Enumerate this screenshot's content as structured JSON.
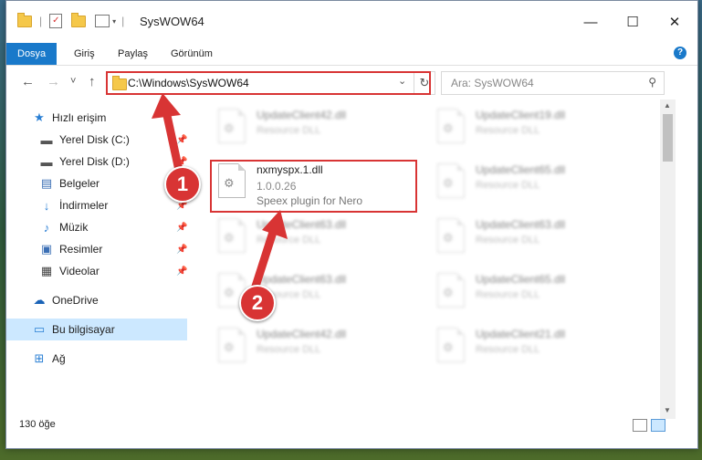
{
  "window": {
    "title": "SysWOW64",
    "controls": {
      "minimize": "—",
      "maximize": "☐",
      "close": "✕"
    }
  },
  "ribbon": {
    "tabs": [
      {
        "label": "Dosya",
        "active": true
      },
      {
        "label": "Giriş",
        "active": false
      },
      {
        "label": "Paylaş",
        "active": false
      },
      {
        "label": "Görünüm",
        "active": false
      }
    ],
    "help": "?"
  },
  "nav": {
    "back": "←",
    "forward": "→",
    "recent": "˅",
    "up": "↑",
    "address": "C:\\Windows\\SysWOW64",
    "address_dropdown": "⌄",
    "refresh": "↻",
    "search_placeholder": "Ara: SysWOW64",
    "search_icon": "⚲"
  },
  "sidebar": {
    "items": [
      {
        "label": "Hızlı erişim",
        "icon": "star-icon",
        "glyph": "★",
        "color": "#2a7fd4"
      },
      {
        "label": "Yerel Disk (C:)",
        "icon": "drive-icon",
        "glyph": "▬",
        "color": "#555555",
        "pinned": true
      },
      {
        "label": "Yerel Disk (D:)",
        "icon": "drive-icon",
        "glyph": "▬",
        "color": "#555555",
        "pinned": true
      },
      {
        "label": "Belgeler",
        "icon": "documents-icon",
        "glyph": "▤",
        "color": "#3b6fb5",
        "pinned": true
      },
      {
        "label": "İndirmeler",
        "icon": "download-icon",
        "glyph": "↓",
        "color": "#2a7fd4",
        "pinned": true
      },
      {
        "label": "Müzik",
        "icon": "music-icon",
        "glyph": "♪",
        "color": "#2a7fd4",
        "pinned": true
      },
      {
        "label": "Resimler",
        "icon": "pictures-icon",
        "glyph": "▣",
        "color": "#3b6fb5",
        "pinned": true
      },
      {
        "label": "Videolar",
        "icon": "video-icon",
        "glyph": "▦",
        "color": "#444444",
        "pinned": true
      },
      {
        "label": "OneDrive",
        "icon": "cloud-icon",
        "glyph": "☁",
        "color": "#1a63b7"
      },
      {
        "label": "Bu bilgisayar",
        "icon": "computer-icon",
        "glyph": "▭",
        "color": "#2a7fd4",
        "selected": true
      },
      {
        "label": "Ağ",
        "icon": "network-icon",
        "glyph": "⊞",
        "color": "#2a7fd4"
      }
    ],
    "pin_glyph": "📌"
  },
  "files": {
    "left": [
      {
        "name": "UpdateClient42.dll",
        "desc": "Resource DLL"
      },
      {
        "name": "nxmyspx.1.dll",
        "version": "1.0.0.26",
        "desc": "Speex plugin for Nero",
        "focused": true
      },
      {
        "name": "UpdateClient63.dll",
        "desc": "Resource DLL"
      },
      {
        "name": "UpdateClient63.dll",
        "desc": "Resource DLL"
      },
      {
        "name": "UpdateClient42.dll",
        "desc": "Resource DLL"
      }
    ],
    "right": [
      {
        "name": "UpdateClient19.dll",
        "desc": "Resource DLL"
      },
      {
        "name": "UpdateClient65.dll",
        "desc": "Resource DLL"
      },
      {
        "name": "UpdateClient63.dll",
        "desc": "Resource DLL"
      },
      {
        "name": "UpdateClient65.dll",
        "desc": "Resource DLL"
      },
      {
        "name": "UpdateClient21.dll",
        "desc": "Resource DLL"
      }
    ],
    "gear_glyph": "⚙"
  },
  "status": {
    "item_count": "130 öğe"
  },
  "annotations": {
    "badge1": "1",
    "badge2": "2",
    "color": "#d83434"
  }
}
